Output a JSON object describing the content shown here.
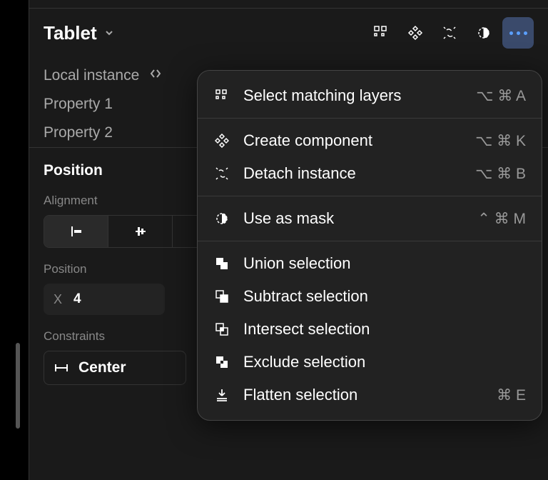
{
  "header": {
    "title": "Tablet"
  },
  "instance": {
    "label": "Local instance",
    "prop1": "Property 1",
    "prop2": "Property 2"
  },
  "position": {
    "title": "Position",
    "alignment_label": "Alignment",
    "position_label": "Position",
    "x_label": "X",
    "x_value": "4",
    "constraints_label": "Constraints",
    "constraint_value": "Center"
  },
  "menu": {
    "select_matching": "Select matching layers",
    "select_matching_shortcut": "⌥ ⌘ A",
    "create_component": "Create component",
    "create_component_shortcut": "⌥ ⌘ K",
    "detach_instance": "Detach instance",
    "detach_instance_shortcut": "⌥ ⌘ B",
    "use_as_mask": "Use as mask",
    "use_as_mask_shortcut": "⌃ ⌘ M",
    "union": "Union selection",
    "subtract": "Subtract selection",
    "intersect": "Intersect selection",
    "exclude": "Exclude selection",
    "flatten": "Flatten selection",
    "flatten_shortcut": "⌘ E"
  }
}
